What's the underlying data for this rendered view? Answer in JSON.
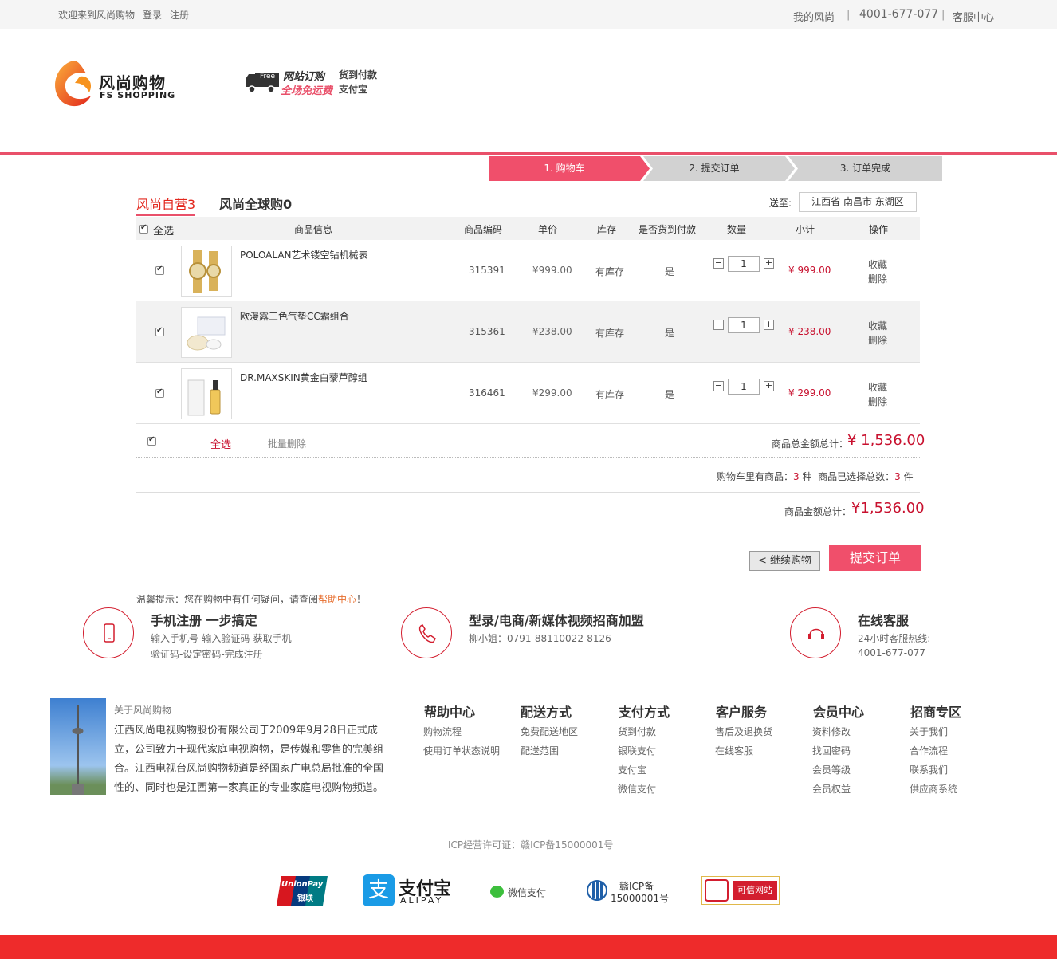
{
  "topbar": {
    "welcome": "欢迎来到风尚购物",
    "login": "登录",
    "register": "注册",
    "my": "我的风尚",
    "sep1": "|",
    "phone": "4001-677-077",
    "sep2": "|",
    "service": "客服中心"
  },
  "logo": {
    "cn": "风尚购物",
    "en": "FS SHOPPING"
  },
  "banner": {
    "free": "Free",
    "line1": "网站订购",
    "line2": "全场免运费",
    "pay1": "货到付款",
    "pay2": "支付宝"
  },
  "steps": [
    "1. 购物车",
    "2. 提交订单",
    "3. 订单完成"
  ],
  "tabs": {
    "self": "风尚自营3",
    "global": "风尚全球购0"
  },
  "ship": {
    "label": "送至:",
    "value": "江西省 南昌市 东湖区"
  },
  "table": {
    "headers": [
      "全选",
      "商品信息",
      "商品编码",
      "单价",
      "库存",
      "是否货到付款",
      "数量",
      "小计",
      "操作"
    ],
    "rows": [
      {
        "name": "POLOALAN艺术镂空钻机械表",
        "code": "315391",
        "price": "¥999.00",
        "stock": "有库存",
        "cod": "是",
        "qty": "1",
        "subtotal": "¥ 999.00",
        "fav": "收藏",
        "del": "删除"
      },
      {
        "name": "欧漫露三色气垫CC霜组合",
        "code": "315361",
        "price": "¥238.00",
        "stock": "有库存",
        "cod": "是",
        "qty": "1",
        "subtotal": "¥ 238.00",
        "fav": "收藏",
        "del": "删除"
      },
      {
        "name": "DR.MAXSKIN黄金白藜芦醇组",
        "code": "316461",
        "price": "¥299.00",
        "stock": "有库存",
        "cod": "是",
        "qty": "1",
        "subtotal": "¥ 299.00",
        "fav": "收藏",
        "del": "删除"
      }
    ]
  },
  "footerbar": {
    "select_all": "全选",
    "batch_delete": "批量删除",
    "total_label": "商品总金额总计：",
    "total": "¥ 1,536.00"
  },
  "summary": {
    "kinds_prefix": "购物车里有商品：",
    "kinds": "3",
    "kinds_unit": "种",
    "selected_prefix": "商品已选择总数：",
    "selected": "3",
    "selected_unit": "件",
    "total_label": "商品金额总计：",
    "total": "¥1,536.00"
  },
  "buttons": {
    "continue": "< 继续购物",
    "submit": "提交订单"
  },
  "tip": {
    "prefix": "温馨提示：您在购物中有任何疑问，请查阅",
    "link": "帮助中心",
    "suffix": "！"
  },
  "services": [
    {
      "title": "手机注册  一步搞定",
      "l1": "输入手机号-输入验证码-获取手机",
      "l2": "验证码-设定密码-完成注册"
    },
    {
      "title": "型录/电商/新媒体视频招商加盟",
      "l1": "柳小姐：0791-88110022-8126",
      "l2": ""
    },
    {
      "title": "在线客服",
      "l1": "24小时客服热线:",
      "l2": "4001-677-077"
    }
  ],
  "about": {
    "title": "关于风尚购物",
    "text": "江西风尚电视购物股份有限公司于2009年9月28日正式成立，公司致力于现代家庭电视购物，是传媒和零售的完美组合。江西电视台风尚购物频道是经国家广电总局批准的全国性的、同时也是江西第一家真正的专业家庭电视购物频道。"
  },
  "footcols": [
    {
      "title": "帮助中心",
      "links": [
        "购物流程",
        "使用订单状态说明"
      ]
    },
    {
      "title": "配送方式",
      "links": [
        "免费配送地区",
        "配送范围"
      ]
    },
    {
      "title": "支付方式",
      "links": [
        "货到付款",
        "银联支付",
        "支付宝",
        "微信支付"
      ]
    },
    {
      "title": "客户服务",
      "links": [
        "售后及退换货",
        "在线客服"
      ]
    },
    {
      "title": "会员中心",
      "links": [
        "资料修改",
        "找回密码",
        "会员等级",
        "会员权益"
      ]
    },
    {
      "title": "招商专区",
      "links": [
        "关于我们",
        "合作流程",
        "联系我们",
        "供应商系统"
      ]
    }
  ],
  "icp": "ICP经营许可证：赣ICP备15000001号",
  "badges": {
    "unionpay1": "UnionPay",
    "unionpay2": "银联",
    "alipay1": "支付宝",
    "alipay2": "ALIPAY",
    "wechat": "微信支付",
    "icp1": "赣ICP备",
    "icp2": "15000001号",
    "credit": "可信网站"
  },
  "colors": {
    "accent": "#e9506a",
    "price": "#c8102e",
    "footer": "#ee2b2b"
  }
}
